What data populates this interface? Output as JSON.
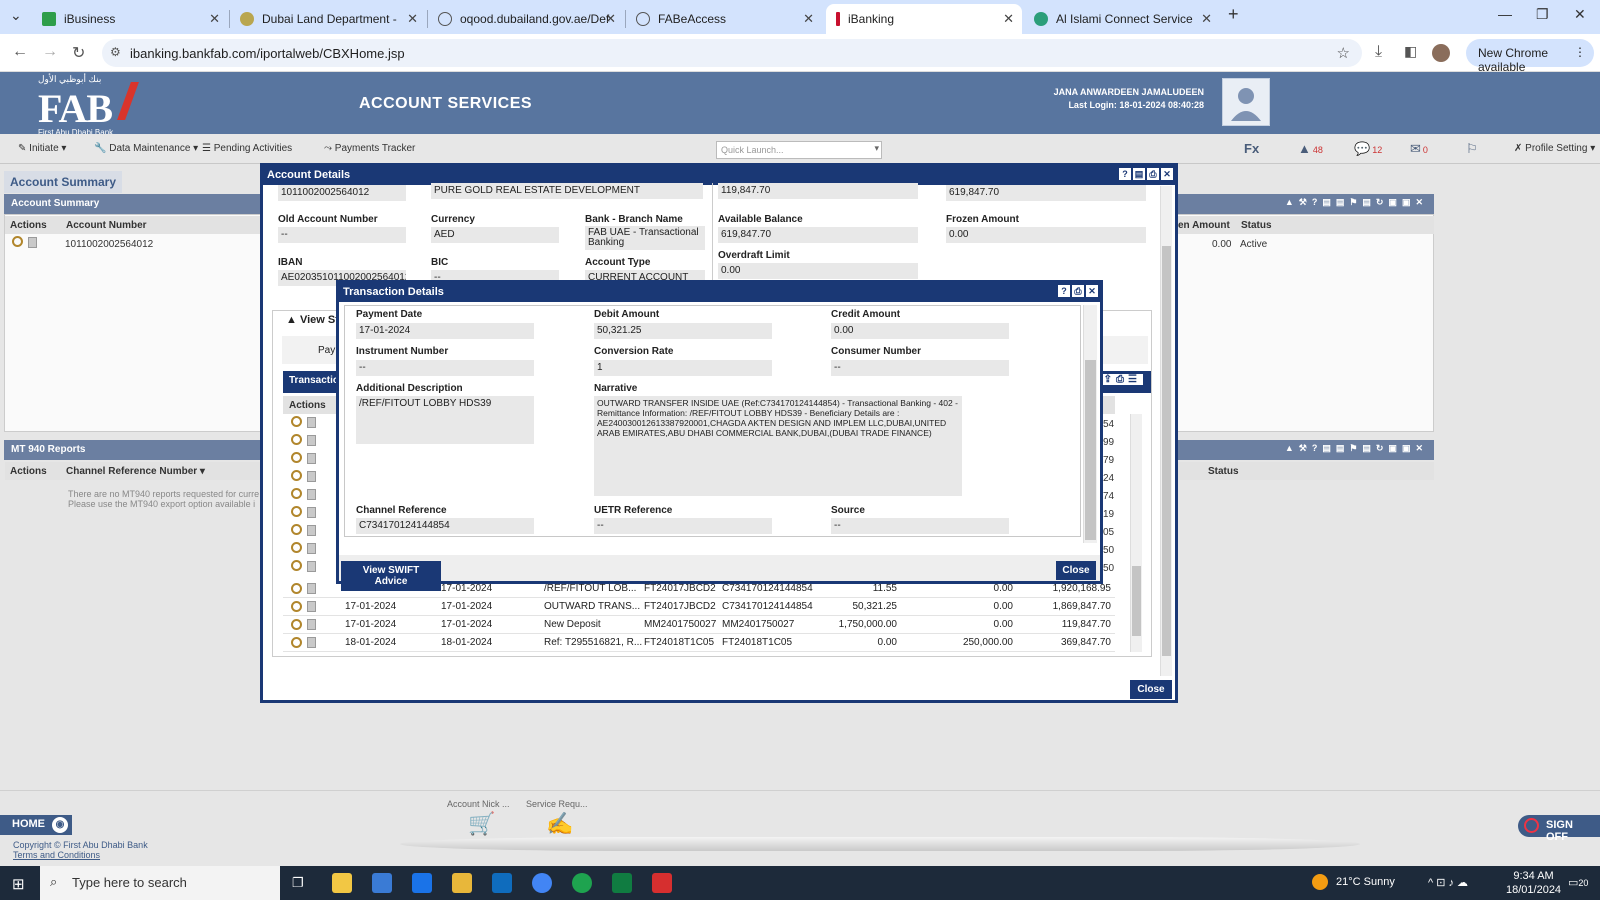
{
  "browser": {
    "tabs": [
      {
        "label": "iBusiness",
        "fav": "#2e9e4a"
      },
      {
        "label": "Dubai Land Department -",
        "fav": "#b9a64f"
      },
      {
        "label": "oqood.dubailand.gov.ae/Defaul",
        "fav": "#666"
      },
      {
        "label": "FABeAccess",
        "fav": "#666"
      },
      {
        "label": "iBanking",
        "fav": "#c8102e"
      },
      {
        "label": "Al Islami Connect Service",
        "fav": "#2b9e7a"
      }
    ],
    "url": "ibanking.bankfab.com/iportalweb/CBXHome.jsp",
    "new_chrome": "New Chrome available"
  },
  "fab": {
    "logo_text": "FAB",
    "logo_sub": "First Abu Dhabi Bank",
    "logo_arabic": "بنك أبوظبي الأول",
    "section_title": "ACCOUNT SERVICES",
    "user_name": "JANA ANWARDEEN JAMALUDEEN",
    "last_login": "Last Login: 18-01-2024 08:40:28",
    "toolbar": {
      "initiate": "Initiate",
      "data_maintenance": "Data Maintenance",
      "pending": "Pending Activities",
      "payments": "Payments Tracker",
      "quick_launch": "Quick Launch...",
      "fx": "Fx",
      "alerts_count": "48",
      "chat_count": "12",
      "mail_count": "0",
      "profile": "Profile Setting"
    }
  },
  "background": {
    "account_summary_tab": "Account Summary",
    "account_summary_panel": "Account Summary",
    "col_actions": "Actions",
    "col_account_number": "Account Number",
    "row_account": "1011002002564012",
    "col_amount": "en Amount",
    "col_status": "Status",
    "row_amount": "0.00",
    "row_status": "Active",
    "mt940_panel": "MT 940 Reports",
    "mt940_col_actions": "Actions",
    "mt940_col_channel": "Channel Reference Number",
    "mt940_col_status": "Status",
    "mt940_note1": "There are no MT940 reports requested for curre",
    "mt940_note2": "Please use the MT940 export option available i"
  },
  "account_details": {
    "title": "Account Details",
    "top_account": "1011002002564012",
    "top_name": "PURE GOLD REAL ESTATE DEVELOPMENT",
    "top_balance1": "119,847.70",
    "top_balance2": "619,847.70",
    "old_account_label": "Old Account Number",
    "old_account_value": "--",
    "currency_label": "Currency",
    "currency_value": "AED",
    "bank_branch_label": "Bank - Branch Name",
    "bank_branch_value": "FAB UAE - Transactional Banking",
    "available_label": "Available Balance",
    "available_value": "619,847.70",
    "frozen_label": "Frozen Amount",
    "frozen_value": "0.00",
    "iban_label": "IBAN",
    "iban_value": "AE020351011002002564012",
    "bic_label": "BIC",
    "bic_value": "--",
    "acct_type_label": "Account Type",
    "acct_type_value": "CURRENT ACCOUNT",
    "overdraft_label": "Overdraft Limit",
    "overdraft_value": "0.00",
    "view_statement": "View St",
    "pay_label": "Pay",
    "transactions_tab": "Transaction",
    "actions_col": "Actions",
    "close": "Close",
    "partial_right_values": [
      "54",
      "99",
      "79",
      "24",
      "74",
      "19",
      "05",
      "50",
      "50"
    ],
    "rows": [
      {
        "date1": "17-01-2024",
        "date2": "17-01-2024",
        "desc": "/REF/FITOUT LOB...",
        "ref1": "FT24017JBCD2",
        "ref2": "C734170124144854",
        "debit": "11.55",
        "credit": "0.00",
        "balance": "1,920,168.95"
      },
      {
        "date1": "17-01-2024",
        "date2": "17-01-2024",
        "desc": "OUTWARD TRANS...",
        "ref1": "FT24017JBCD2",
        "ref2": "C734170124144854",
        "debit": "50,321.25",
        "credit": "0.00",
        "balance": "1,869,847.70"
      },
      {
        "date1": "17-01-2024",
        "date2": "17-01-2024",
        "desc": "New Deposit",
        "ref1": "MM2401750027",
        "ref2": "MM2401750027",
        "debit": "1,750,000.00",
        "credit": "0.00",
        "balance": "119,847.70"
      },
      {
        "date1": "18-01-2024",
        "date2": "18-01-2024",
        "desc": "Ref: T295516821, R...",
        "ref1": "FT24018T1C05",
        "ref2": "FT24018T1C05",
        "debit": "0.00",
        "credit": "250,000.00",
        "balance": "369,847.70"
      }
    ]
  },
  "transaction_details": {
    "title": "Transaction Details",
    "payment_date_label": "Payment Date",
    "payment_date_value": "17-01-2024",
    "debit_label": "Debit Amount",
    "debit_value": "50,321.25",
    "credit_label": "Credit Amount",
    "credit_value": "0.00",
    "instrument_label": "Instrument Number",
    "instrument_value": "--",
    "conversion_label": "Conversion Rate",
    "conversion_value": "1",
    "consumer_label": "Consumer Number",
    "consumer_value": "--",
    "addl_desc_label": "Additional Description",
    "addl_desc_value": "/REF/FITOUT LOBBY HDS39",
    "narrative_label": "Narrative",
    "narrative_value": "OUTWARD TRANSFER INSIDE UAE (Ref:C734170124144854) - Transactional Banking - 402 - Remittance Information: /REF/FITOUT LOBBY HDS39 - Beneficiary Details are : AE240030012613387920001,CHAGDA AKTEN DESIGN AND IMPLEM LLC,DUBAI,UNITED ARAB EMIRATES,ABU DHABI COMMERCIAL BANK,DUBAI,(DUBAI TRADE FINANCE)",
    "channel_ref_label": "Channel Reference",
    "channel_ref_value": "C734170124144854",
    "uetr_label": "UETR Reference",
    "uetr_value": "--",
    "source_label": "Source",
    "source_value": "--",
    "view_swift": "View SWIFT Advice",
    "close": "Close"
  },
  "footer": {
    "home": "HOME",
    "copyright": "Copyright © First Abu Dhabi Bank",
    "terms": "Terms and Conditions",
    "signoff": "SIGN OFF",
    "shortcut1": "Account Nick ...",
    "shortcut2": "Service Requ..."
  },
  "taskbar": {
    "search_placeholder": "Type here to search",
    "weather": "21°C  Sunny",
    "time": "9:34 AM",
    "date": "18/01/2024",
    "notif_count": "20"
  }
}
